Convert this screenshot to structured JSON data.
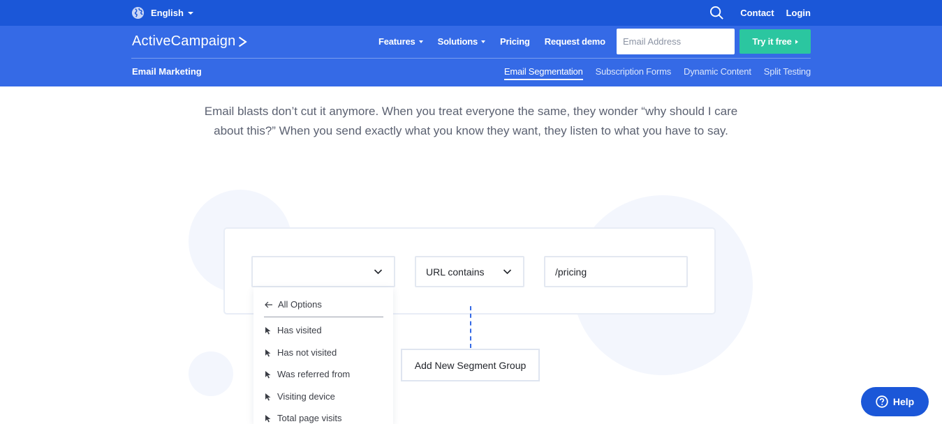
{
  "topbar": {
    "language": "English",
    "links": {
      "contact": "Contact",
      "login": "Login"
    },
    "icons": {
      "language": "globe-icon",
      "search": "search-icon"
    }
  },
  "nav": {
    "logo": "ActiveCampaign",
    "items": [
      {
        "label": "Features",
        "has_caret": true
      },
      {
        "label": "Solutions",
        "has_caret": true
      },
      {
        "label": "Pricing",
        "has_caret": false
      },
      {
        "label": "Request demo",
        "has_caret": false
      }
    ],
    "email_placeholder": "Email Address",
    "cta": "Try it free"
  },
  "subnav": {
    "section": "Email Marketing",
    "tabs": [
      "Email Segmentation",
      "Subscription Forms",
      "Dynamic Content",
      "Split Testing"
    ],
    "active": "Email Segmentation"
  },
  "intro": "Email blasts don’t cut it anymore. When you treat everyone the same, they wonder “why should I care about this?” When you send exactly what you know they want, they listen to what you have to say.",
  "builder": {
    "field1_value": "",
    "field2_value": "URL contains",
    "field3_value": "/pricing",
    "add_group": "Add New Segment Group",
    "dropdown": {
      "back": "All Options",
      "options": [
        "Has visited",
        "Has not visited",
        "Was referred from",
        "Visiting device",
        "Total page visits"
      ]
    }
  },
  "help": "Help",
  "colors": {
    "topbar": "#1b57d8",
    "nav": "#356ae6",
    "cta": "#2bc6a0",
    "help": "#1b57d8"
  }
}
